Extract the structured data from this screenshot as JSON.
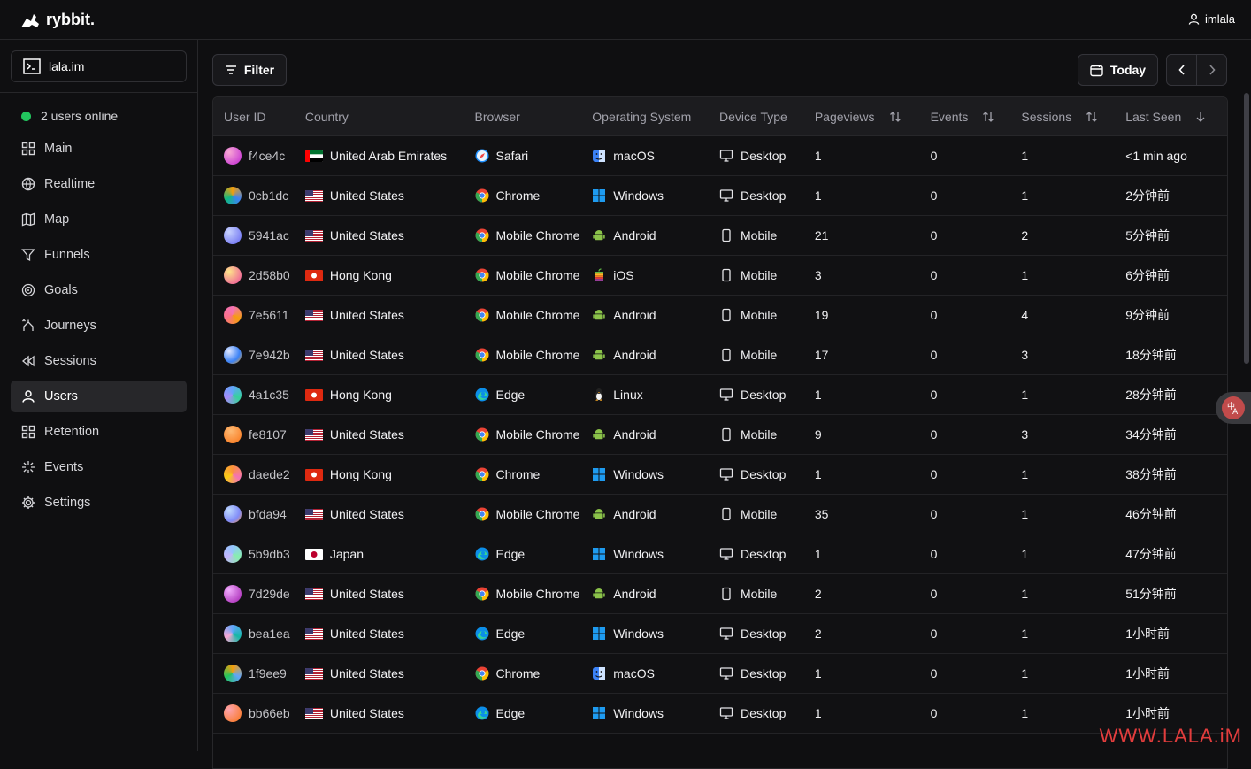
{
  "brand": {
    "name": "rybbit."
  },
  "user": {
    "name": "imlala"
  },
  "site": {
    "name": "lala.im"
  },
  "online": {
    "text": "2 users online"
  },
  "nav": [
    {
      "label": "Main",
      "icon": "grid-icon",
      "active": false
    },
    {
      "label": "Realtime",
      "icon": "globe-icon",
      "active": false
    },
    {
      "label": "Map",
      "icon": "map-icon",
      "active": false
    },
    {
      "label": "Funnels",
      "icon": "funnel-icon",
      "active": false
    },
    {
      "label": "Goals",
      "icon": "target-icon",
      "active": false
    },
    {
      "label": "Journeys",
      "icon": "split-icon",
      "active": false
    },
    {
      "label": "Sessions",
      "icon": "rewind-icon",
      "active": false
    },
    {
      "label": "Users",
      "icon": "user-icon",
      "active": true
    },
    {
      "label": "Retention",
      "icon": "grid-icon",
      "active": false
    },
    {
      "label": "Events",
      "icon": "sparkle-icon",
      "active": false
    },
    {
      "label": "Settings",
      "icon": "gear-icon",
      "active": false
    }
  ],
  "toolbar": {
    "filter_label": "Filter",
    "date_label": "Today"
  },
  "table": {
    "headers": [
      "User ID",
      "Country",
      "Browser",
      "Operating System",
      "Device Type",
      "Pageviews",
      "Events",
      "Sessions",
      "Last Seen"
    ],
    "rows": [
      {
        "id": "f4ce4c",
        "country": "United Arab Emirates",
        "browser": "Safari",
        "os": "macOS",
        "device": "Desktop",
        "pageviews": "1",
        "events": "0",
        "sessions": "1",
        "last_seen": "<1 min ago"
      },
      {
        "id": "0cb1dc",
        "country": "United States",
        "browser": "Chrome",
        "os": "Windows",
        "device": "Desktop",
        "pageviews": "1",
        "events": "0",
        "sessions": "1",
        "last_seen": "2分钟前"
      },
      {
        "id": "5941ac",
        "country": "United States",
        "browser": "Mobile Chrome",
        "os": "Android",
        "device": "Mobile",
        "pageviews": "21",
        "events": "0",
        "sessions": "2",
        "last_seen": "5分钟前"
      },
      {
        "id": "2d58b0",
        "country": "Hong Kong",
        "browser": "Mobile Chrome",
        "os": "iOS",
        "device": "Mobile",
        "pageviews": "3",
        "events": "0",
        "sessions": "1",
        "last_seen": "6分钟前"
      },
      {
        "id": "7e5611",
        "country": "United States",
        "browser": "Mobile Chrome",
        "os": "Android",
        "device": "Mobile",
        "pageviews": "19",
        "events": "0",
        "sessions": "4",
        "last_seen": "9分钟前"
      },
      {
        "id": "7e942b",
        "country": "United States",
        "browser": "Mobile Chrome",
        "os": "Android",
        "device": "Mobile",
        "pageviews": "17",
        "events": "0",
        "sessions": "3",
        "last_seen": "18分钟前"
      },
      {
        "id": "4a1c35",
        "country": "Hong Kong",
        "browser": "Edge",
        "os": "Linux",
        "device": "Desktop",
        "pageviews": "1",
        "events": "0",
        "sessions": "1",
        "last_seen": "28分钟前"
      },
      {
        "id": "fe8107",
        "country": "United States",
        "browser": "Mobile Chrome",
        "os": "Android",
        "device": "Mobile",
        "pageviews": "9",
        "events": "0",
        "sessions": "3",
        "last_seen": "34分钟前"
      },
      {
        "id": "daede2",
        "country": "Hong Kong",
        "browser": "Chrome",
        "os": "Windows",
        "device": "Desktop",
        "pageviews": "1",
        "events": "0",
        "sessions": "1",
        "last_seen": "38分钟前"
      },
      {
        "id": "bfda94",
        "country": "United States",
        "browser": "Mobile Chrome",
        "os": "Android",
        "device": "Mobile",
        "pageviews": "35",
        "events": "0",
        "sessions": "1",
        "last_seen": "46分钟前"
      },
      {
        "id": "5b9db3",
        "country": "Japan",
        "browser": "Edge",
        "os": "Windows",
        "device": "Desktop",
        "pageviews": "1",
        "events": "0",
        "sessions": "1",
        "last_seen": "47分钟前"
      },
      {
        "id": "7d29de",
        "country": "United States",
        "browser": "Mobile Chrome",
        "os": "Android",
        "device": "Mobile",
        "pageviews": "2",
        "events": "0",
        "sessions": "1",
        "last_seen": "51分钟前"
      },
      {
        "id": "bea1ea",
        "country": "United States",
        "browser": "Edge",
        "os": "Windows",
        "device": "Desktop",
        "pageviews": "2",
        "events": "0",
        "sessions": "1",
        "last_seen": "1小时前"
      },
      {
        "id": "1f9ee9",
        "country": "United States",
        "browser": "Chrome",
        "os": "macOS",
        "device": "Desktop",
        "pageviews": "1",
        "events": "0",
        "sessions": "1",
        "last_seen": "1小时前"
      },
      {
        "id": "bb66eb",
        "country": "United States",
        "browser": "Edge",
        "os": "Windows",
        "device": "Desktop",
        "pageviews": "1",
        "events": "0",
        "sessions": "1",
        "last_seen": "1小时前"
      }
    ]
  },
  "watermark": "WWW.LALA.iM"
}
